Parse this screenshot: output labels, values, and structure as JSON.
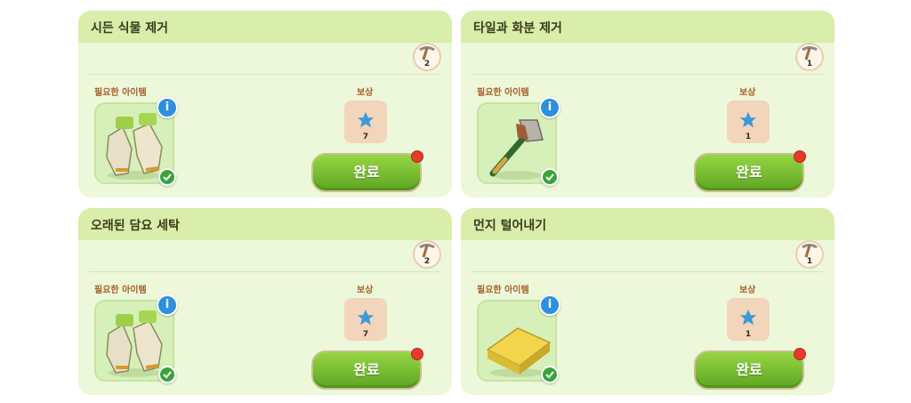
{
  "labels": {
    "required_items": "필요한 아이템",
    "reward": "보상",
    "complete": "완료"
  },
  "tasks": [
    {
      "title": "시든 식물 제거",
      "tool_count": "2",
      "item_icon": "gloves-icon",
      "reward_icon": "star-icon",
      "reward_count": "7"
    },
    {
      "title": "타일과 화분 제거",
      "tool_count": "1",
      "item_icon": "axe-icon",
      "reward_icon": "star-icon",
      "reward_count": "1"
    },
    {
      "title": "오래된 담요 세탁",
      "tool_count": "2",
      "item_icon": "gloves-icon",
      "reward_icon": "star-icon",
      "reward_count": "7"
    },
    {
      "title": "먼지 털어내기",
      "tool_count": "1",
      "item_icon": "sponge-icon",
      "reward_icon": "star-icon",
      "reward_count": "1"
    }
  ],
  "colors": {
    "card_bg": "#edf7d9",
    "card_header": "#d8eeaa",
    "complete_button": "#7cc234",
    "reward_tile": "#f2d5ba",
    "star": "#3a9ad9",
    "alert_dot": "#e83a2b"
  }
}
